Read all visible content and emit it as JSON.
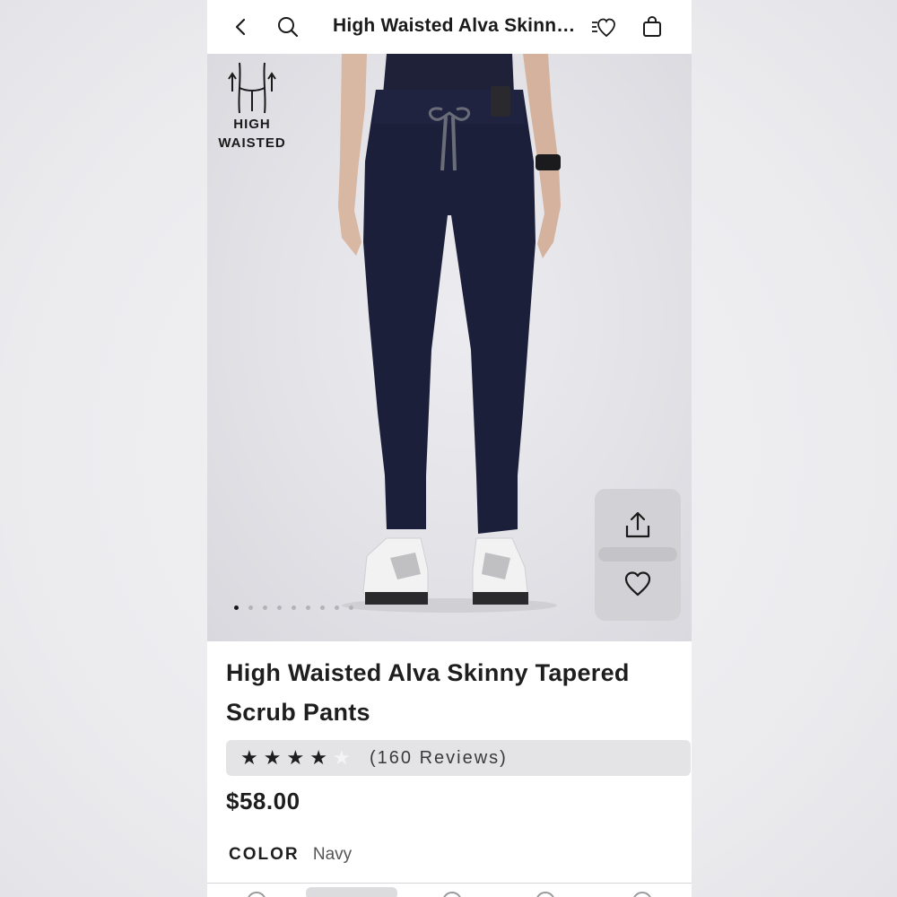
{
  "nav": {
    "title": "High Waisted Alva Skinny Tapered Scrub Pants",
    "icons": [
      "chevron-left-icon",
      "search-icon",
      "wishlist-icon",
      "bag-icon"
    ]
  },
  "hero": {
    "badge_line1": "HIGH",
    "badge_line2": "WAISTED",
    "image_count": 9,
    "active_image": 1,
    "pants_color": "#1c1f3a"
  },
  "product": {
    "title": "High Waisted Alva Skinny Tapered Scrub Pants",
    "rating": 4,
    "rating_max": 5,
    "reviews": "(160 Reviews)",
    "price": "$58.00",
    "color_label": "COLOR",
    "color_value": "Navy"
  }
}
